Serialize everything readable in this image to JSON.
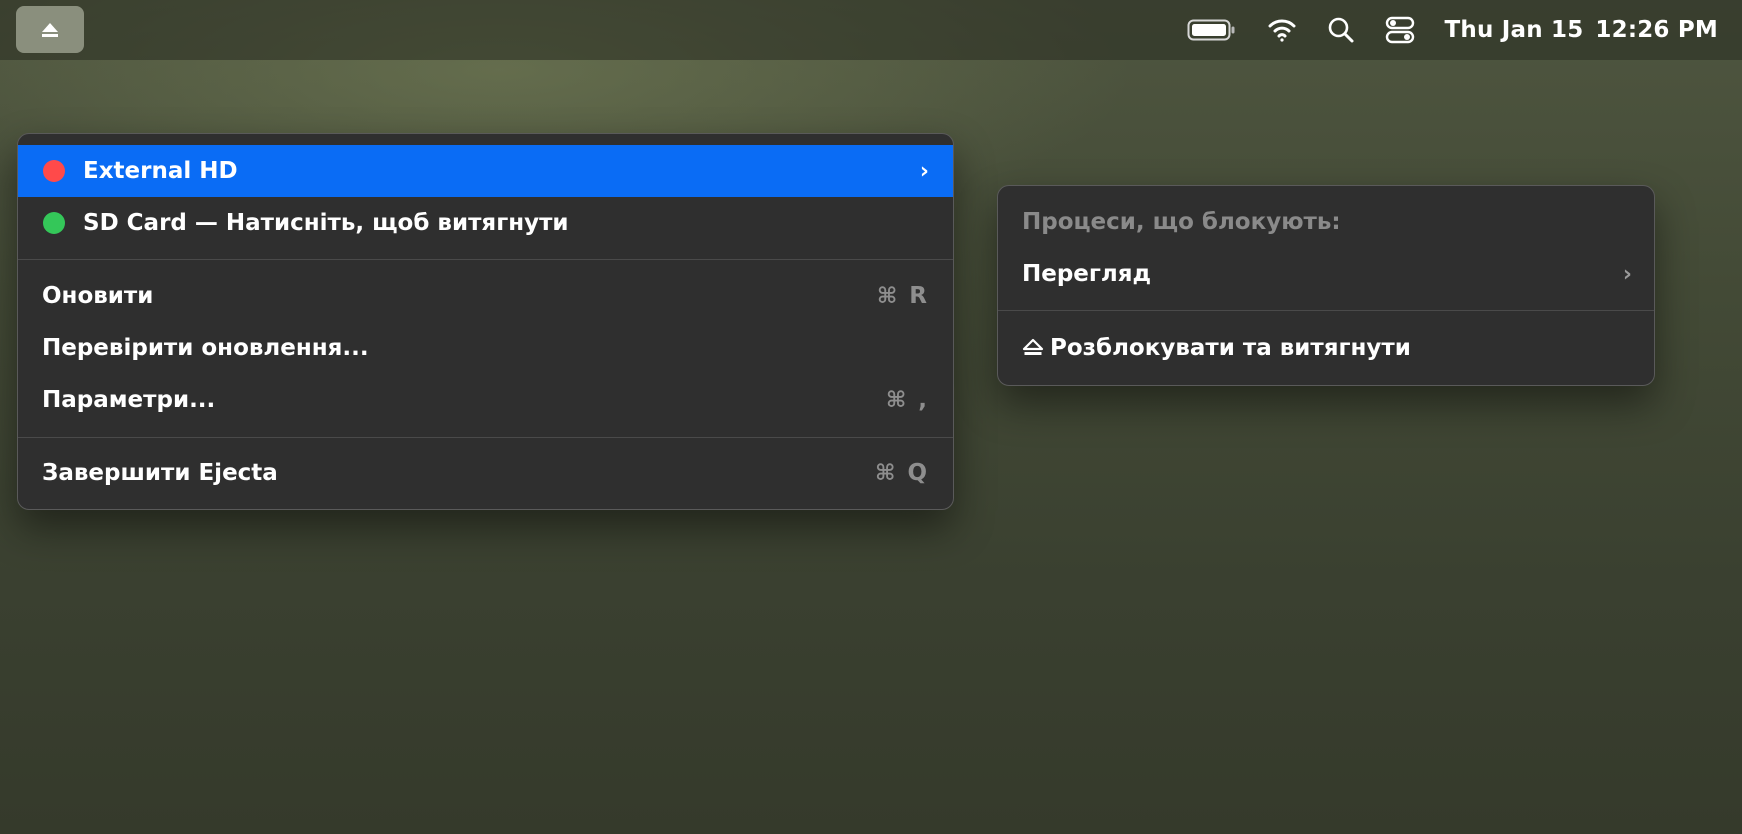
{
  "menubar": {
    "eject_icon": "eject-icon",
    "status_icons": [
      "battery-icon",
      "wifi-icon",
      "search-icon",
      "control-center-icon"
    ],
    "date": "Thu Jan 15",
    "time": "12:26 PM"
  },
  "menu": {
    "drives": [
      {
        "label": "External HD",
        "status_color": "#ff4a4a",
        "has_submenu": true,
        "highlighted": true
      },
      {
        "label": "SD Card — Натисніть, щоб витягнути",
        "status_color": "#34c759",
        "has_submenu": false,
        "highlighted": false
      }
    ],
    "actions": [
      {
        "label": "Оновити",
        "shortcut_symbol": "⌘",
        "shortcut_key": "R"
      },
      {
        "label": "Перевірити оновлення...",
        "shortcut_symbol": "",
        "shortcut_key": ""
      },
      {
        "label": "Параметри...",
        "shortcut_symbol": "⌘",
        "shortcut_key": ","
      }
    ],
    "quit": {
      "label": "Завершити Ejecta",
      "shortcut_symbol": "⌘",
      "shortcut_key": "Q"
    }
  },
  "submenu": {
    "header": "Процеси, що блокують:",
    "view_label": "Перегляд",
    "unlock_label": "Розблокувати та витягнути"
  },
  "colors": {
    "highlight": "#0a6cf5",
    "menu_bg": "#2f2f2f"
  }
}
